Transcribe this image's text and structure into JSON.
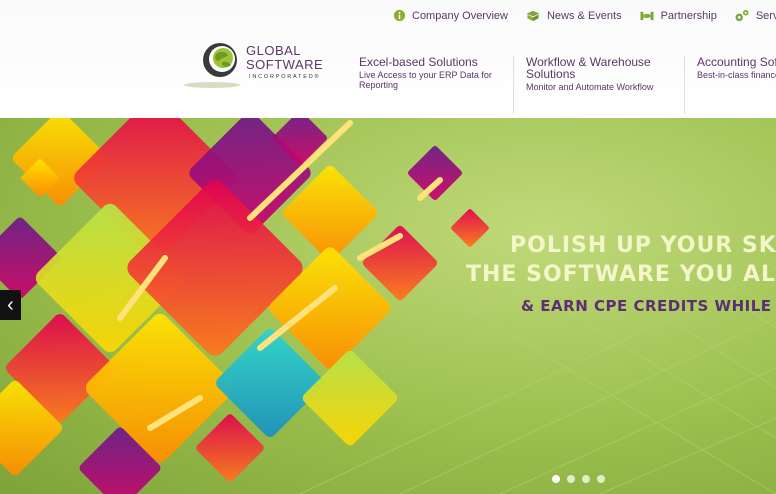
{
  "topnav": {
    "company_overview": "Company Overview",
    "news_events": "News & Events",
    "partnership": "Partnership",
    "services": "Services"
  },
  "logo": {
    "line1": "GLOBAL",
    "line2": "SOFTWARE",
    "line3": "INCORPORATED®"
  },
  "menu": [
    {
      "title": "Excel-based Solutions",
      "subtitle": "Live Access to your ERP Data for Reporting"
    },
    {
      "title": "Workflow & Warehouse Solutions",
      "subtitle": "Monitor and Automate Workflow"
    },
    {
      "title": "Accounting Software",
      "subtitle": "Best-in-class finance technology"
    }
  ],
  "hero": {
    "line1": "POLISH UP YOUR SKILLS",
    "line2": "THE SOFTWARE YOU ALREADY",
    "line3": "& EARN CPE CREDITS WHILE"
  },
  "slider": {
    "prev_icon": "chevron-left-icon",
    "slide_count": 4,
    "active_slide": 1
  },
  "colors": {
    "brand_purple": "#5c3566",
    "hero_green": "#9bbf4d",
    "headline_cream": "#f2f6c8",
    "cta_purple": "#5d2f72"
  }
}
